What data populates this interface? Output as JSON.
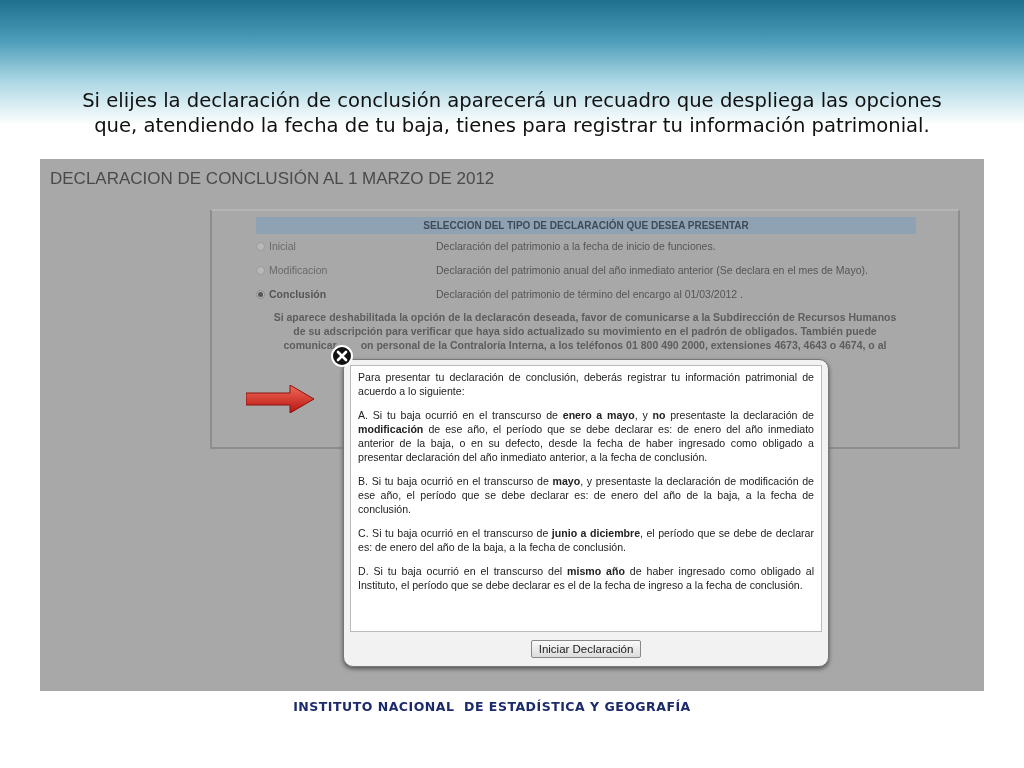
{
  "caption": "Si elijes la declaración de conclusión aparecerá un recuadro que despliega las opciones que, atendiendo la fecha de tu baja, tienes para registrar tu información patrimonial.",
  "screen": {
    "title": "DECLARACION DE CONCLUSIÓN AL 1 MARZO DE 2012",
    "panel_header": "SELECCION DEL TIPO DE DECLARACIÓN QUE DESEA PRESENTAR",
    "options": [
      {
        "label": "Inicial",
        "description": "Declaración del patrimonio a la fecha de inicio de funciones.",
        "selected": false,
        "disabled": true
      },
      {
        "label": "Modificacion",
        "description": "Declaración del patrimonio anual del año inmediato anterior (Se declara en el mes de Mayo).",
        "selected": false,
        "disabled": true
      },
      {
        "label": "Conclusión",
        "description": "Declaración del patrimonio de término del encargo al 01/03/2012 .",
        "selected": true,
        "disabled": false
      }
    ],
    "note_lines": [
      "Si aparece deshabilitada la opción de la declaracón deseada, favor de comunicarse a la Subdirección de Recursos Humanos",
      "de su adscripción para verificar que haya sido actualizado su movimiento en el padrón de obligados. También puede"
    ],
    "note_cut": [
      "comunicar",
      "on personal de la Contraloría Interna, a los teléfonos 01 800 490 2000, extensiones 4673, 4643 o 4674, o al"
    ]
  },
  "modal": {
    "paragraphs": [
      "Para presentar tu declaración de conclusión, deberás registrar tu información patrimonial de acuerdo a lo siguiente:",
      "A. Si tu baja ocurrió en el transcurso de **enero a mayo**, y **no** presentaste la declaración de **modificación** de ese año, el período que se debe declarar es: de enero del año inmediato anterior de la baja, o en su defecto, desde la fecha de haber ingresado como obligado a presentar declaración del año inmediato anterior, a la fecha de conclusión.",
      "B. Si tu baja ocurrió en el transcurso de **mayo**, y presentaste la declaración de modificación de ese año, el período que se debe declarar es: de enero del año de la baja, a la fecha de conclusión.",
      "C. Si tu baja ocurrió en el transcurso de **junio a diciembre**, el período que se debe de declarar es: de enero del año de la baja, a la fecha de conclusión.",
      "D. Si tu baja ocurrió en el transcurso del **mismo año** de haber ingresado como obligado al Instituto, el período que se debe declarar es el de la fecha de ingreso a la fecha de conclusión."
    ],
    "button": "Iniciar Declaración"
  },
  "footer": "INSTITUTO NACIONAL  DE ESTADÍSTICA Y GEOGRAFÍA"
}
